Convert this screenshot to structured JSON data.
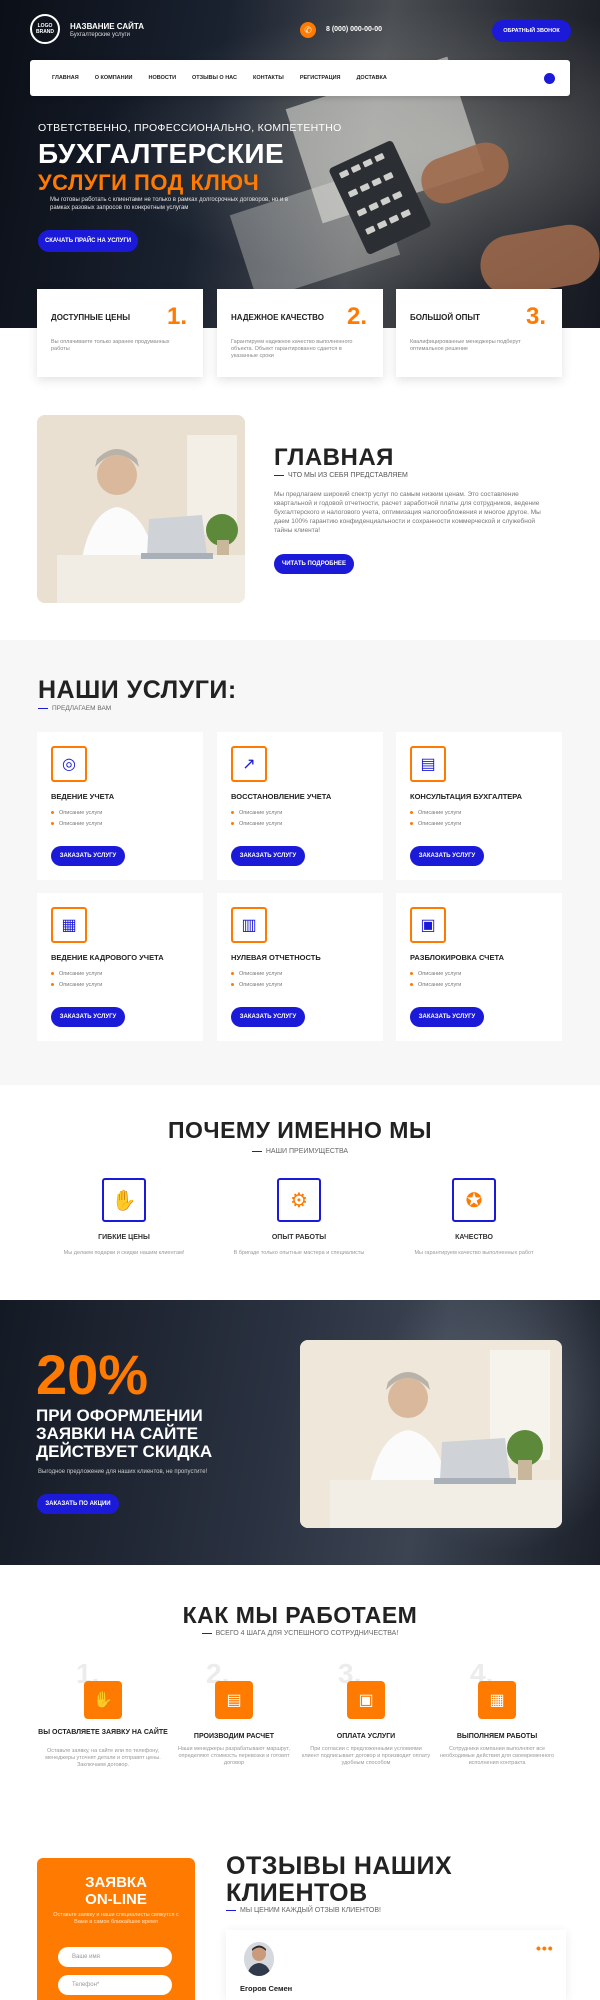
{
  "header": {
    "logo_text": "LOGO\nBRAND",
    "site_title": "НАЗВАНИЕ САЙТА",
    "site_subtitle": "Бухгалтерские услуги",
    "phone_icon": "phone-icon",
    "phone": "8 (000) 000-00-00",
    "callback_button": "ОБРАТНЫЙ ЗВОНОК"
  },
  "nav": {
    "items": [
      "ГЛАВНАЯ",
      "О КОМПАНИИ",
      "НОВОСТИ",
      "ОТЗЫВЫ О НАС",
      "КОНТАКТЫ",
      "РЕГИСТРАЦИЯ",
      "ДОСТАВКА"
    ]
  },
  "hero": {
    "kicker": "ОТВЕТСТВЕННО, ПРОФЕССИОНАЛЬНО, КОМПЕТЕНТНО",
    "title_line1": "БУХГАЛТЕРСКИЕ",
    "title_line2": "УСЛУГИ ПОД КЛЮЧ",
    "description": "Мы готовы работать с клиентами не только в рамках долгосрочных договоров, но и в рамках разовых запросов по конкретным услугам",
    "button": "СКАЧАТЬ ПРАЙС НА УСЛУГИ"
  },
  "features": [
    {
      "title": "ДОСТУПНЫЕ ЦЕНЫ",
      "num": "1.",
      "desc": "Вы оплачиваете только заранее продуманных работы"
    },
    {
      "title": "НАДЕЖНОЕ КАЧЕСТВО",
      "num": "2.",
      "desc": "Гарантируем надежное качество выполненного объекта. Объект гарантированно сдается в указанные сроки"
    },
    {
      "title": "БОЛЬШОЙ ОПЫТ",
      "num": "3.",
      "desc": "Квалифицированные менеджеры подберут оптимальное решение"
    }
  ],
  "about": {
    "title": "ГЛАВНАЯ",
    "subtitle": "ЧТО МЫ ИЗ СЕБЯ ПРЕДСТАВЛЯЕМ",
    "text": "Мы предлагаем широкий спектр услуг по самым низким ценам. Это составление квартальной и годовой отчетности, расчет заработной платы для сотрудников, ведение бухгалтерского и налогового учета, оптимизация налогообложения и многое другое. Мы даем 100% гарантию конфиденциальности и сохранности коммерческой и служебной тайны клиента!",
    "button": "ЧИТАТЬ ПОДРОБНЕЕ"
  },
  "services": {
    "title": "НАШИ УСЛУГИ:",
    "subtitle": "ПРЕДЛАГАЕМ ВАМ",
    "item_text": "Описание услуги",
    "button": "ЗАКАЗАТЬ УСЛУГУ",
    "items": [
      {
        "title": "ВЕДЕНИЕ УЧЕТА",
        "icon": "coins-icon"
      },
      {
        "title": "ВОССТАНОВЛЕНИЕ УЧЕТА",
        "icon": "chart-growth-icon"
      },
      {
        "title": "КОНСУЛЬТАЦИЯ БУХГАЛТЕРА",
        "icon": "presentation-icon"
      },
      {
        "title": "ВЕДЕНИЕ КАДРОВОГО УЧЕТА",
        "icon": "documents-icon"
      },
      {
        "title": "НУЛЕВАЯ ОТЧЕТНОСТЬ",
        "icon": "report-icon"
      },
      {
        "title": "РАЗБЛОКИРОВКА СЧЕТА",
        "icon": "account-unlock-icon"
      }
    ]
  },
  "why": {
    "title": "ПОЧЕМУ ИМЕННО МЫ",
    "subtitle": "НАШИ ПРЕИМУЩЕСТВА",
    "items": [
      {
        "label": "ГИБКИЕ ЦЕНЫ",
        "desc": "Мы делаем подарки и скидки нашим клиентам!",
        "icon": "hand-coin-icon"
      },
      {
        "label": "ОПЫТ РАБОТЫ",
        "desc": "В бригаде только опытные мастера и специалисты",
        "icon": "gears-icon"
      },
      {
        "label": "КАЧЕСТВО",
        "desc": "Мы гарантируем качество выполненных работ",
        "icon": "quality-icon"
      }
    ]
  },
  "promo": {
    "percent": "20%",
    "line1": "ПРИ ОФОРМЛЕНИИ",
    "line2": "ЗАЯВКИ НА САЙТЕ",
    "line3": "ДЕЙСТВУЕТ СКИДКА",
    "description": "Выгодное предложение для наших клиентов, не пропустите!",
    "button": "ЗАКАЗАТЬ ПО АКЦИИ"
  },
  "steps": {
    "title": "КАК МЫ РАБОТАЕМ",
    "subtitle": "ВСЕГО 4 ШАГА ДЛЯ УСПЕШНОГО СОТРУДНИЧЕСТВА!",
    "items": [
      {
        "num": "1.",
        "title": "ВЫ ОСТАВЛЯЕТЕ ЗАЯВКУ НА САЙТЕ",
        "desc": "Оставьте заявку, на сайте или по телефону, менеджеры уточнят детали и отправят цены. Заключаем договор.",
        "icon": "handshake-icon"
      },
      {
        "num": "2.",
        "title": "ПРОИЗВОДИМ РАСЧЕТ",
        "desc": "Наши менеджеры разрабатывают маршрут, определяют стоимость перевозки и готовят договор",
        "icon": "calculator-icon"
      },
      {
        "num": "3.",
        "title": "ОПЛАТА УСЛУГИ",
        "desc": "При согласии с предложенными условиями клиент подписывает договор и производит оплату удобным способом",
        "icon": "wallet-icon"
      },
      {
        "num": "4.",
        "title": "ВЫПОЛНЯЕМ РАБОТЫ",
        "desc": "Сотрудники компании выполняют все необходимые действия для своевременного исполнения контракта",
        "icon": "box-icon"
      }
    ]
  },
  "form": {
    "title_line1": "ЗАЯВКА",
    "title_line2": "ON-LINE",
    "description": "Оставьте заявку и наши специалисты свяжутся с Вами в самое ближайшее время",
    "name_placeholder": "Ваше имя",
    "phone_placeholder": "Телефон*"
  },
  "reviews": {
    "title_line1": "ОТЗЫВЫ НАШИХ",
    "title_line2": "КЛИЕНТОВ",
    "subtitle": "МЫ ЦЕНИМ КАЖДЫЙ ОТЗЫВ КЛИЕНТОВ!",
    "name": "Егоров Семен",
    "quote_mark": "•••"
  },
  "colors": {
    "accent": "#ff7a00",
    "primary": "#1b1ad8"
  }
}
